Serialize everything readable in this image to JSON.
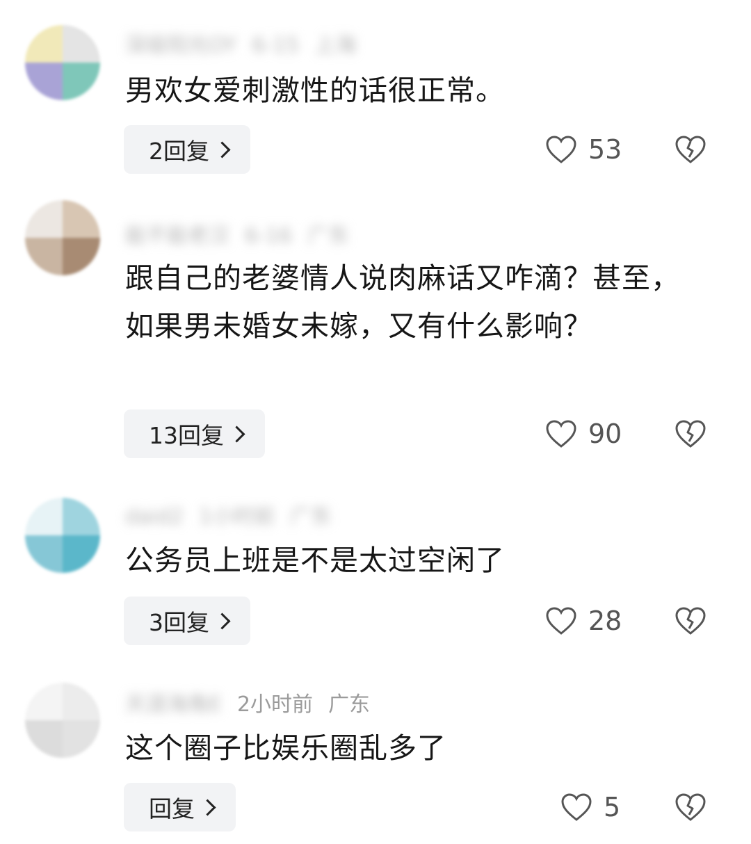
{
  "comments": [
    {
      "meta_name": "深级阳光OY",
      "meta_time": "6-15",
      "meta_location": "上海",
      "text": "男欢女爱刺激性的话很正常。",
      "reply_label": "2回复",
      "likes": "53",
      "avatar_colors": [
        "#f1e9b9",
        "#a9a3d6",
        "#7fc7b9",
        "#e4e4e4"
      ]
    },
    {
      "meta_name": "能不能老汉",
      "meta_time": "6-16",
      "meta_location": "广东",
      "text": "跟自己的老婆情人说肉麻话又咋滴？甚至，如果男未婚女未嫁，又有什么影响？",
      "reply_label": "13回复",
      "likes": "90",
      "avatar_colors": [
        "#d8c6b3",
        "#a88b73",
        "#ece7e2",
        "#c9b5a2"
      ]
    },
    {
      "meta_name": "daid2",
      "meta_time": "1小时前",
      "meta_location": "广东",
      "text": "公务员上班是不是太过空闲了",
      "reply_label": "3回复",
      "likes": "28",
      "avatar_colors": [
        "#9fd4df",
        "#5bb7ca",
        "#e7f3f6",
        "#86c7d6"
      ]
    },
    {
      "meta_name": "天涯海角E",
      "meta_time": "2小时前",
      "meta_location": "广东",
      "text": "这个圈子比娱乐圈乱多了",
      "reply_label": "回复",
      "likes": "5",
      "avatar_colors": [
        "#ececec",
        "#dcdcdc",
        "#f4f4f4",
        "#e2e2e2"
      ]
    }
  ],
  "icons": {
    "like": "heart-outline-icon",
    "dislike": "broken-heart-icon",
    "reply_chevron": "chevron-right-icon"
  },
  "colors": {
    "text": "#161616",
    "meta": "#9b9b9b",
    "reply_bg": "#f2f3f5",
    "icon": "#555555"
  }
}
